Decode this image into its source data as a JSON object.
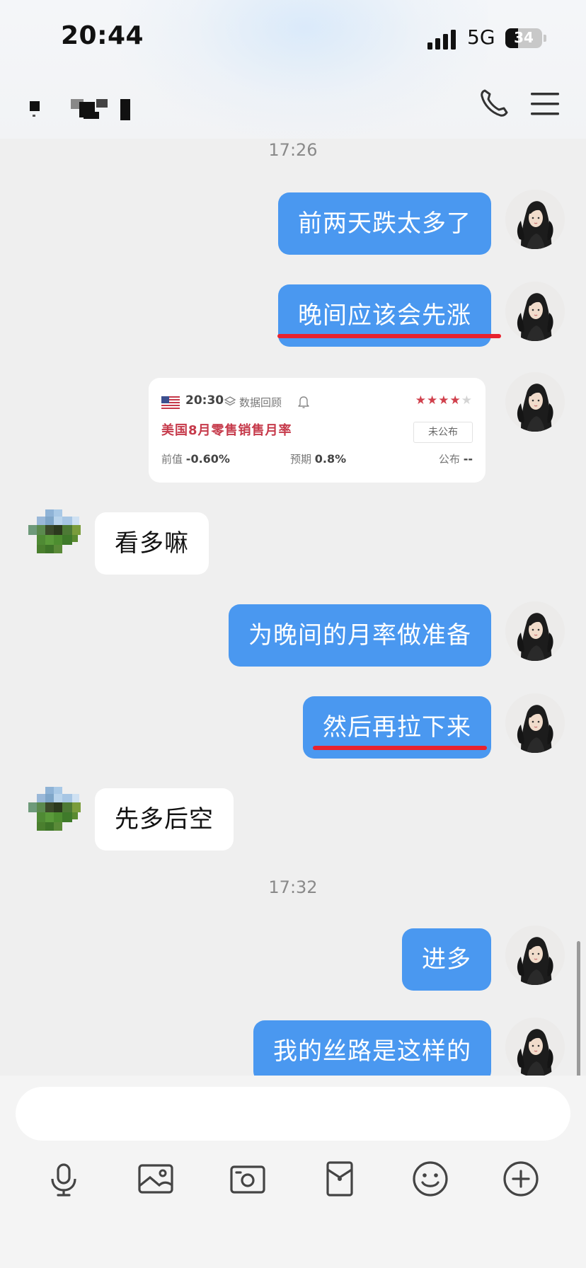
{
  "status_bar": {
    "time": "20:44",
    "network": "5G",
    "battery": "34",
    "battery_level": 0.34
  },
  "header": {
    "call_icon": "phone-icon",
    "menu_icon": "menu-icon"
  },
  "messages": [
    {
      "type": "timestamp",
      "text": "17:26"
    },
    {
      "type": "out",
      "text": "前两天跌太多了"
    },
    {
      "type": "out",
      "text": "晚间应该会先涨",
      "underlined": true
    },
    {
      "type": "card"
    },
    {
      "type": "in",
      "text": "看多嘛"
    },
    {
      "type": "out",
      "text": "为晚间的月率做准备"
    },
    {
      "type": "out",
      "text": "然后再拉下来",
      "underlined": true
    },
    {
      "type": "in",
      "text": "先多后空"
    },
    {
      "type": "timestamp",
      "text": "17:32"
    },
    {
      "type": "out",
      "text": "进多"
    },
    {
      "type": "out",
      "text": "我的丝路是这样的"
    }
  ],
  "card": {
    "time": "20:30",
    "review_label": "数据回顾",
    "title": "美国8月零售销售月率",
    "status": "未公布",
    "stars_filled": 4,
    "stars_total": 5,
    "previous_label": "前值",
    "previous_value": "-0.60%",
    "forecast_label": "预期",
    "forecast_value": "0.8%",
    "actual_label": "公布",
    "actual_value": "--"
  },
  "toolbar": [
    {
      "name": "microphone-icon"
    },
    {
      "name": "image-icon"
    },
    {
      "name": "camera-icon"
    },
    {
      "name": "red-packet-icon"
    },
    {
      "name": "emoji-icon"
    },
    {
      "name": "plus-icon"
    }
  ],
  "colors": {
    "accent": "#4a98f0",
    "underline": "#e8222e",
    "card_title": "#c63a4b",
    "star": "#d0404c"
  }
}
